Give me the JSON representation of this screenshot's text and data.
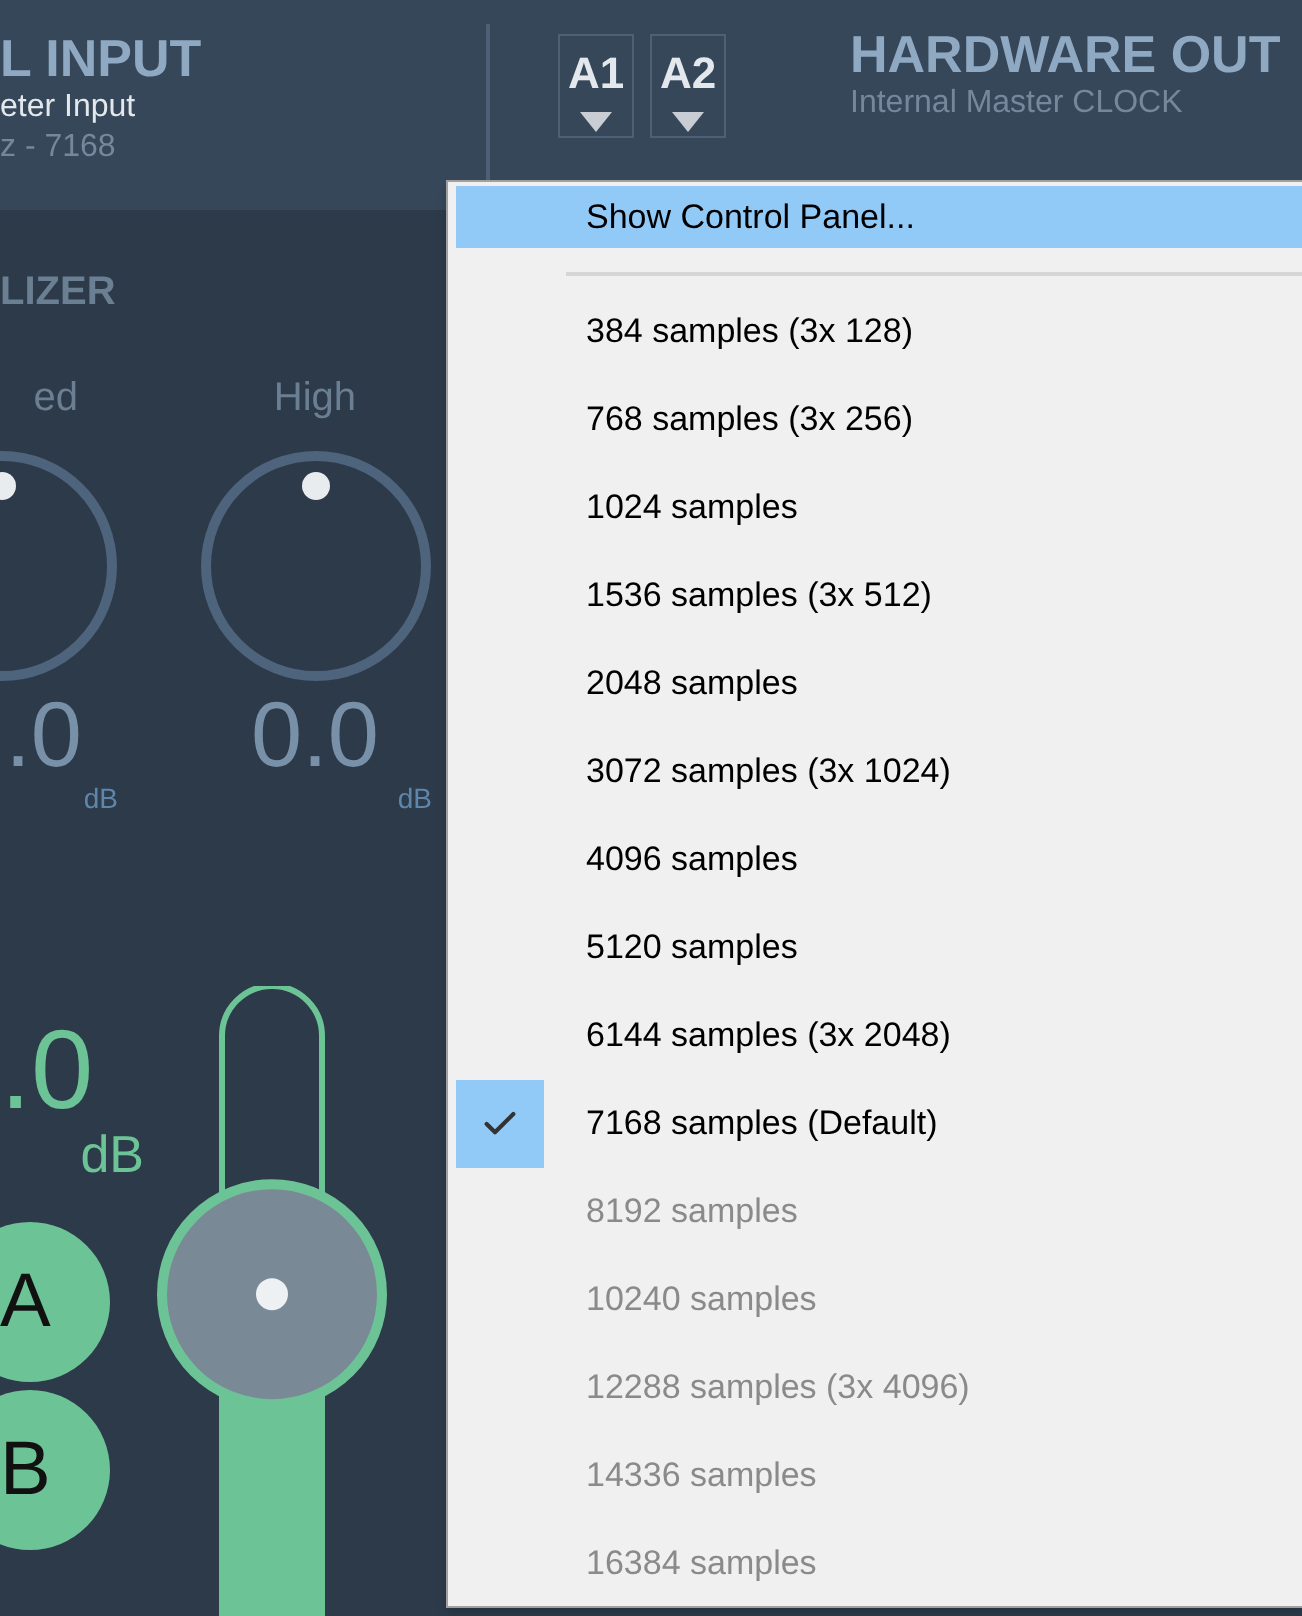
{
  "input_strip": {
    "title": "L INPUT",
    "subtitle": "eter Input",
    "info": "z - 7168",
    "section_title": "LIZER",
    "knobs": [
      {
        "label": "ed",
        "value": ".0",
        "unit": "dB"
      },
      {
        "label": "High",
        "value": "0.0",
        "unit": "dB"
      }
    ],
    "gain": {
      "value": ".0",
      "unit": "dB"
    },
    "fader": {
      "level": 0.52
    },
    "buses": [
      {
        "label": "A"
      },
      {
        "label": "B"
      }
    ]
  },
  "output_header": {
    "buttons": [
      {
        "label": "A1"
      },
      {
        "label": "A2"
      }
    ],
    "title": "HARDWARE OUT",
    "subtitle": "Internal Master CLOCK"
  },
  "context_menu": {
    "header_item": {
      "label": "Show Control Panel...",
      "highlighted": true
    },
    "options": [
      {
        "label": "384 samples (3x 128)",
        "checked": false,
        "disabled": false
      },
      {
        "label": "768 samples (3x 256)",
        "checked": false,
        "disabled": false
      },
      {
        "label": "1024 samples",
        "checked": false,
        "disabled": false
      },
      {
        "label": "1536 samples (3x 512)",
        "checked": false,
        "disabled": false
      },
      {
        "label": "2048 samples",
        "checked": false,
        "disabled": false
      },
      {
        "label": "3072 samples (3x 1024)",
        "checked": false,
        "disabled": false
      },
      {
        "label": "4096 samples",
        "checked": false,
        "disabled": false
      },
      {
        "label": "5120 samples",
        "checked": false,
        "disabled": false
      },
      {
        "label": "6144 samples (3x 2048)",
        "checked": false,
        "disabled": false
      },
      {
        "label": "7168 samples (Default)",
        "checked": true,
        "disabled": false
      },
      {
        "label": "8192 samples",
        "checked": false,
        "disabled": true
      },
      {
        "label": "10240 samples",
        "checked": false,
        "disabled": true
      },
      {
        "label": "12288 samples (3x 4096)",
        "checked": false,
        "disabled": true
      },
      {
        "label": "14336 samples",
        "checked": false,
        "disabled": true
      },
      {
        "label": "16384 samples",
        "checked": false,
        "disabled": true
      }
    ]
  }
}
